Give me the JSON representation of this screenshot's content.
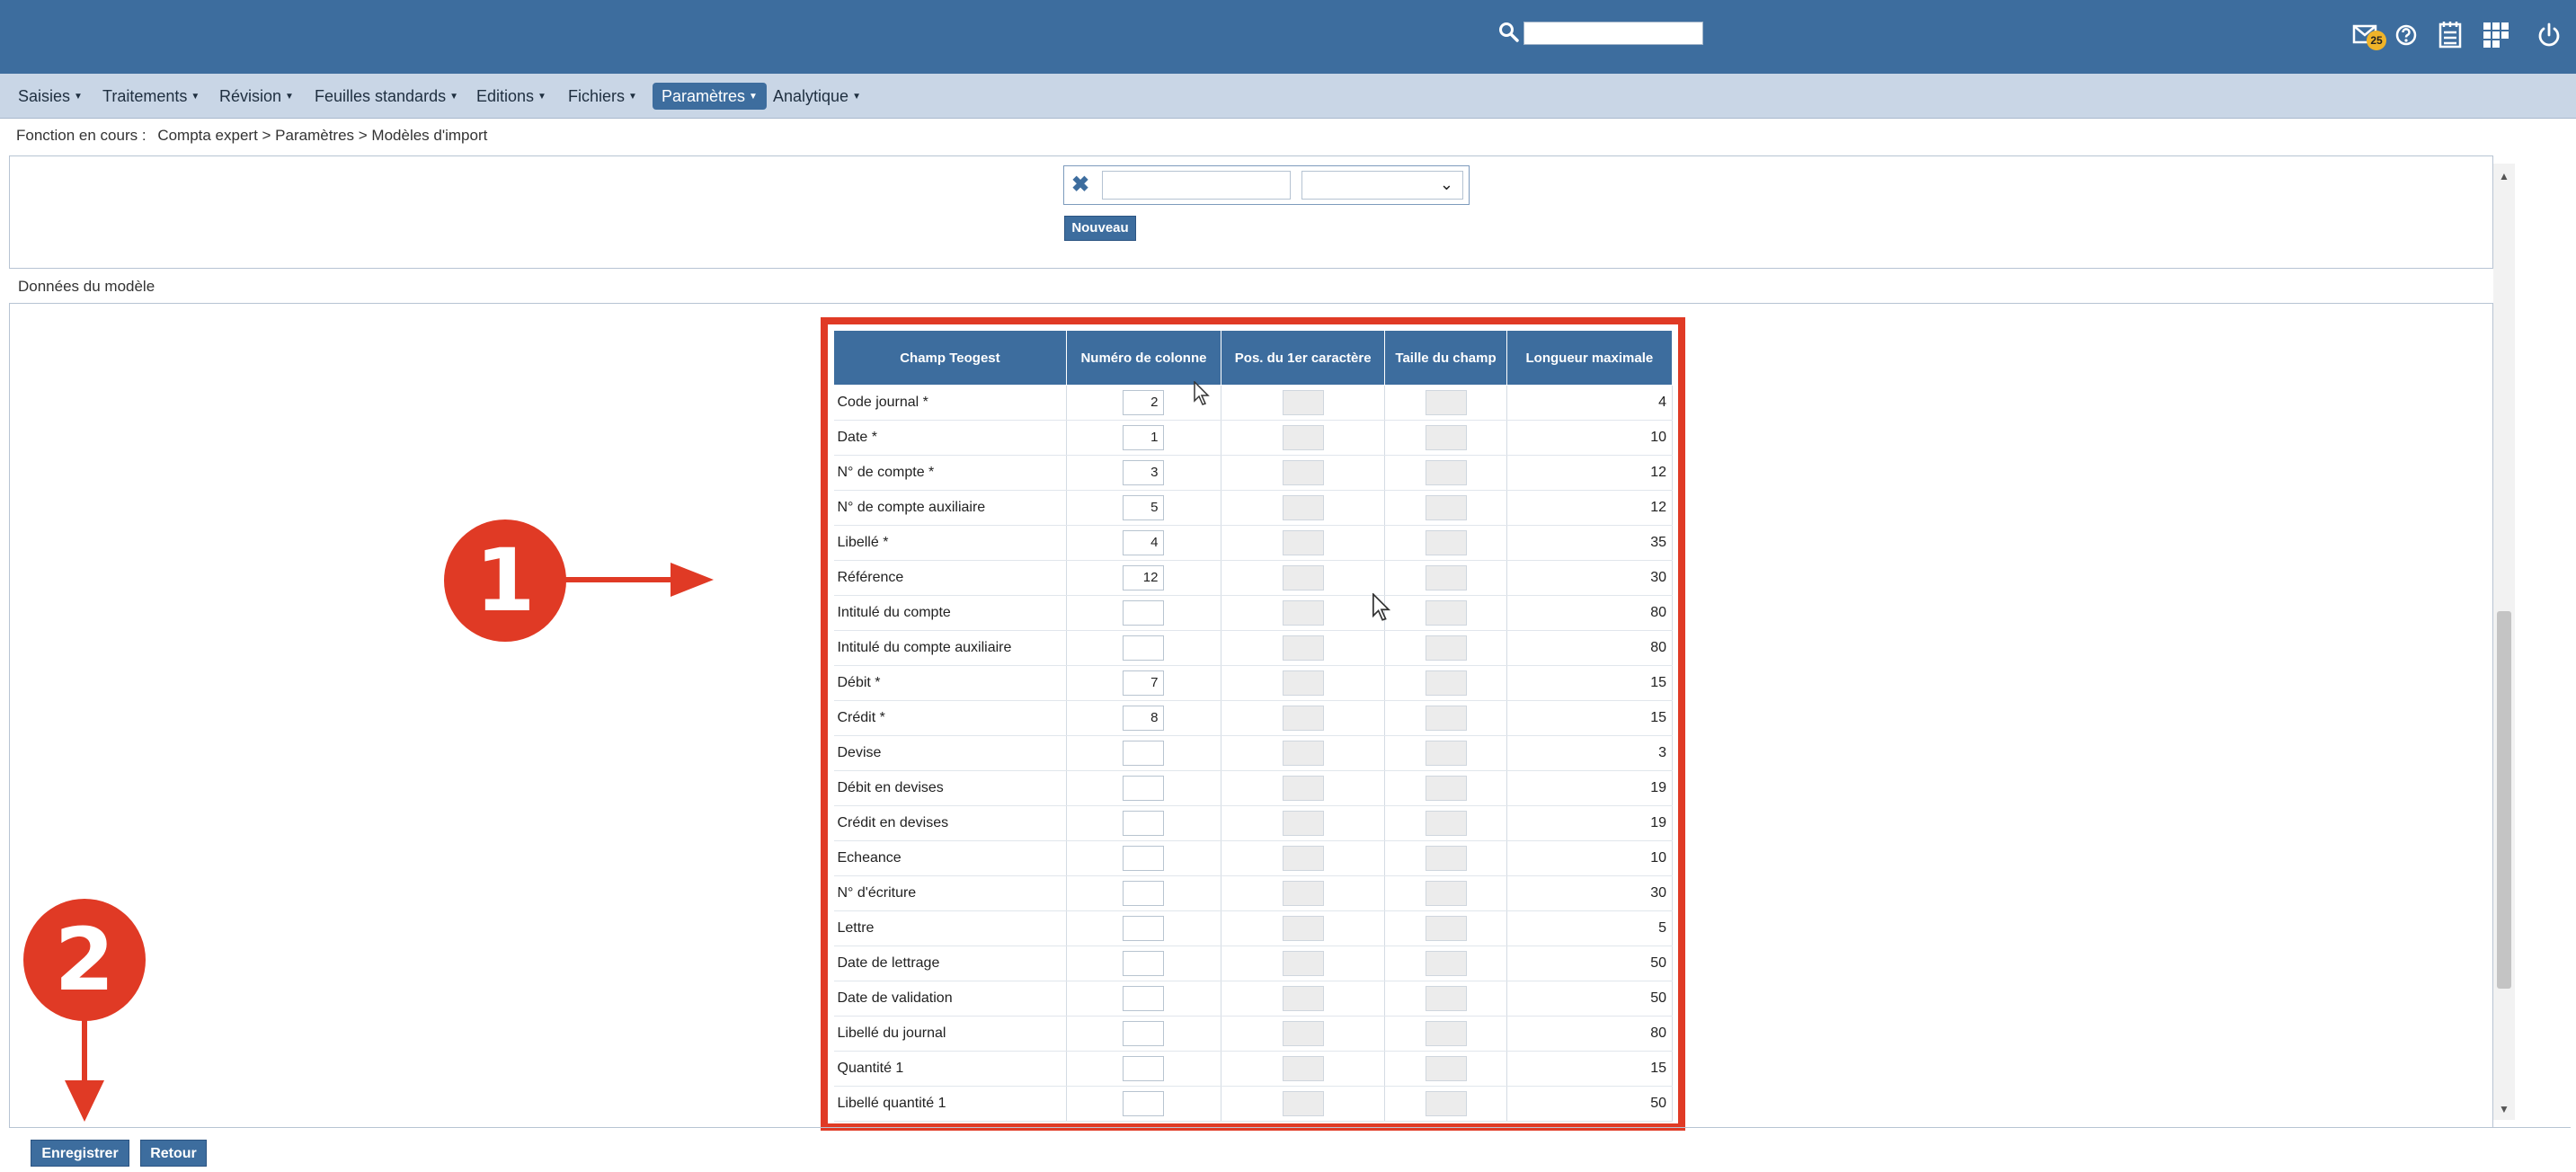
{
  "search": {
    "value": ""
  },
  "notifications": {
    "count": "25"
  },
  "menu": [
    {
      "label": "Saisies",
      "active": false
    },
    {
      "label": "Traitements",
      "active": false
    },
    {
      "label": "Révision",
      "active": false
    },
    {
      "label": "Feuilles standards",
      "active": false
    },
    {
      "label": "Editions",
      "active": false
    },
    {
      "label": "Fichiers",
      "active": false
    },
    {
      "label": "Paramètres",
      "active": true
    },
    {
      "label": "Analytique",
      "active": false
    }
  ],
  "breadcrumb": {
    "prefix": "Fonction en cours :",
    "path": "Compta expert > Paramètres > Modèles d'import"
  },
  "toolbar": {
    "new_label": "Nouveau"
  },
  "section": {
    "title": "Données du modèle"
  },
  "table": {
    "headers": [
      "Champ Teogest",
      "Numéro de colonne",
      "Pos. du 1er caractère",
      "Taille du champ",
      "Longueur maximale"
    ],
    "rows": [
      {
        "field": "Code journal *",
        "col": "2",
        "max": "4"
      },
      {
        "field": "Date *",
        "col": "1",
        "max": "10"
      },
      {
        "field": "N° de compte *",
        "col": "3",
        "max": "12"
      },
      {
        "field": "N° de compte auxiliaire",
        "col": "5",
        "max": "12"
      },
      {
        "field": "Libellé *",
        "col": "4",
        "max": "35"
      },
      {
        "field": "Référence",
        "col": "12",
        "max": "30"
      },
      {
        "field": "Intitulé du compte",
        "col": "",
        "max": "80"
      },
      {
        "field": "Intitulé du compte auxiliaire",
        "col": "",
        "max": "80"
      },
      {
        "field": "Débit *",
        "col": "7",
        "max": "15"
      },
      {
        "field": "Crédit *",
        "col": "8",
        "max": "15"
      },
      {
        "field": "Devise",
        "col": "",
        "max": "3"
      },
      {
        "field": "Débit en devises",
        "col": "",
        "max": "19"
      },
      {
        "field": "Crédit en devises",
        "col": "",
        "max": "19"
      },
      {
        "field": "Echeance",
        "col": "",
        "max": "10"
      },
      {
        "field": "N° d'écriture",
        "col": "",
        "max": "30"
      },
      {
        "field": "Lettre",
        "col": "",
        "max": "5"
      },
      {
        "field": "Date de lettrage",
        "col": "",
        "max": "50"
      },
      {
        "field": "Date de validation",
        "col": "",
        "max": "50"
      },
      {
        "field": "Libellé du journal",
        "col": "",
        "max": "80"
      },
      {
        "field": "Quantité 1",
        "col": "",
        "max": "15"
      },
      {
        "field": "Libellé quantité 1",
        "col": "",
        "max": "50"
      }
    ]
  },
  "footer": {
    "save_label": "Enregistrer",
    "back_label": "Retour"
  },
  "annotations": {
    "step1": "1",
    "step2": "2",
    "color": "#e03a25"
  }
}
